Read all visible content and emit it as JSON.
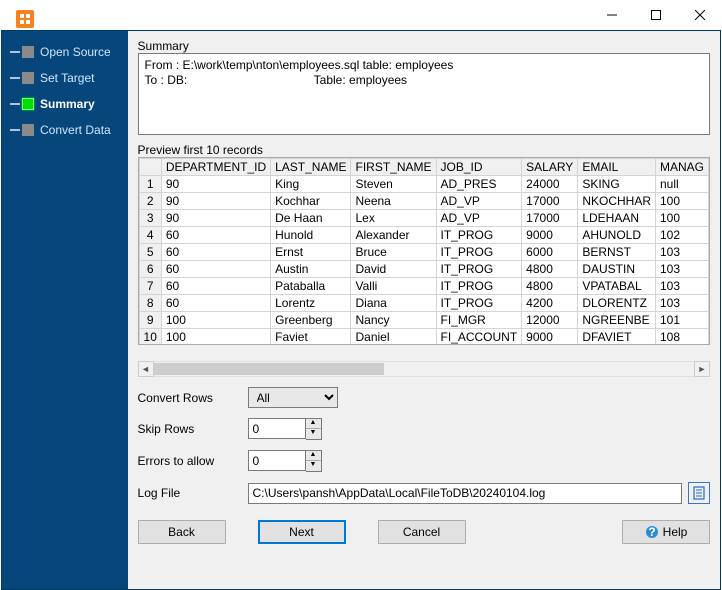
{
  "window": {
    "min_icon": "minimize-icon",
    "max_icon": "maximize-icon",
    "close_icon": "close-icon"
  },
  "sidebar": {
    "steps": [
      {
        "label": "Open Source",
        "active": false
      },
      {
        "label": "Set Target",
        "active": false
      },
      {
        "label": "Summary",
        "active": true
      },
      {
        "label": "Convert Data",
        "active": false
      }
    ]
  },
  "summary": {
    "label": "Summary",
    "text": "From : E:\\work\\temp\\nton\\employees.sql table: employees\nTo : DB:                                      Table: employees"
  },
  "preview": {
    "label": "Preview first 10 records",
    "columns": [
      "DEPARTMENT_ID",
      "LAST_NAME",
      "FIRST_NAME",
      "JOB_ID",
      "SALARY",
      "EMAIL",
      "MANAG"
    ],
    "rows": [
      {
        "n": "1",
        "DEPARTMENT_ID": "90",
        "LAST_NAME": "King",
        "FIRST_NAME": "Steven",
        "JOB_ID": "AD_PRES",
        "SALARY": "24000",
        "EMAIL": "SKING",
        "MANAG": "null"
      },
      {
        "n": "2",
        "DEPARTMENT_ID": "90",
        "LAST_NAME": "Kochhar",
        "FIRST_NAME": "Neena",
        "JOB_ID": "AD_VP",
        "SALARY": "17000",
        "EMAIL": "NKOCHHAR",
        "MANAG": "100"
      },
      {
        "n": "3",
        "DEPARTMENT_ID": "90",
        "LAST_NAME": "De Haan",
        "FIRST_NAME": "Lex",
        "JOB_ID": "AD_VP",
        "SALARY": "17000",
        "EMAIL": "LDEHAAN",
        "MANAG": "100"
      },
      {
        "n": "4",
        "DEPARTMENT_ID": "60",
        "LAST_NAME": "Hunold",
        "FIRST_NAME": "Alexander",
        "JOB_ID": "IT_PROG",
        "SALARY": "9000",
        "EMAIL": "AHUNOLD",
        "MANAG": "102"
      },
      {
        "n": "5",
        "DEPARTMENT_ID": "60",
        "LAST_NAME": "Ernst",
        "FIRST_NAME": "Bruce",
        "JOB_ID": "IT_PROG",
        "SALARY": "6000",
        "EMAIL": "BERNST",
        "MANAG": "103"
      },
      {
        "n": "6",
        "DEPARTMENT_ID": "60",
        "LAST_NAME": "Austin",
        "FIRST_NAME": "David",
        "JOB_ID": "IT_PROG",
        "SALARY": "4800",
        "EMAIL": "DAUSTIN",
        "MANAG": "103"
      },
      {
        "n": "7",
        "DEPARTMENT_ID": "60",
        "LAST_NAME": "Pataballa",
        "FIRST_NAME": "Valli",
        "JOB_ID": "IT_PROG",
        "SALARY": "4800",
        "EMAIL": "VPATABAL",
        "MANAG": "103"
      },
      {
        "n": "8",
        "DEPARTMENT_ID": "60",
        "LAST_NAME": "Lorentz",
        "FIRST_NAME": "Diana",
        "JOB_ID": "IT_PROG",
        "SALARY": "4200",
        "EMAIL": "DLORENTZ",
        "MANAG": "103"
      },
      {
        "n": "9",
        "DEPARTMENT_ID": "100",
        "LAST_NAME": "Greenberg",
        "FIRST_NAME": "Nancy",
        "JOB_ID": "FI_MGR",
        "SALARY": "12000",
        "EMAIL": "NGREENBE",
        "MANAG": "101"
      },
      {
        "n": "10",
        "DEPARTMENT_ID": "100",
        "LAST_NAME": "Faviet",
        "FIRST_NAME": "Daniel",
        "JOB_ID": "FI_ACCOUNT",
        "SALARY": "9000",
        "EMAIL": "DFAVIET",
        "MANAG": "108"
      }
    ]
  },
  "options": {
    "convert_rows_label": "Convert Rows",
    "convert_rows_value": "All",
    "skip_rows_label": "Skip Rows",
    "skip_rows_value": "0",
    "errors_label": "Errors to allow",
    "errors_value": "0",
    "logfile_label": "Log File",
    "logfile_value": "C:\\Users\\pansh\\AppData\\Local\\FileToDB\\20240104.log"
  },
  "buttons": {
    "back": "Back",
    "next": "Next",
    "cancel": "Cancel",
    "help": "Help"
  }
}
